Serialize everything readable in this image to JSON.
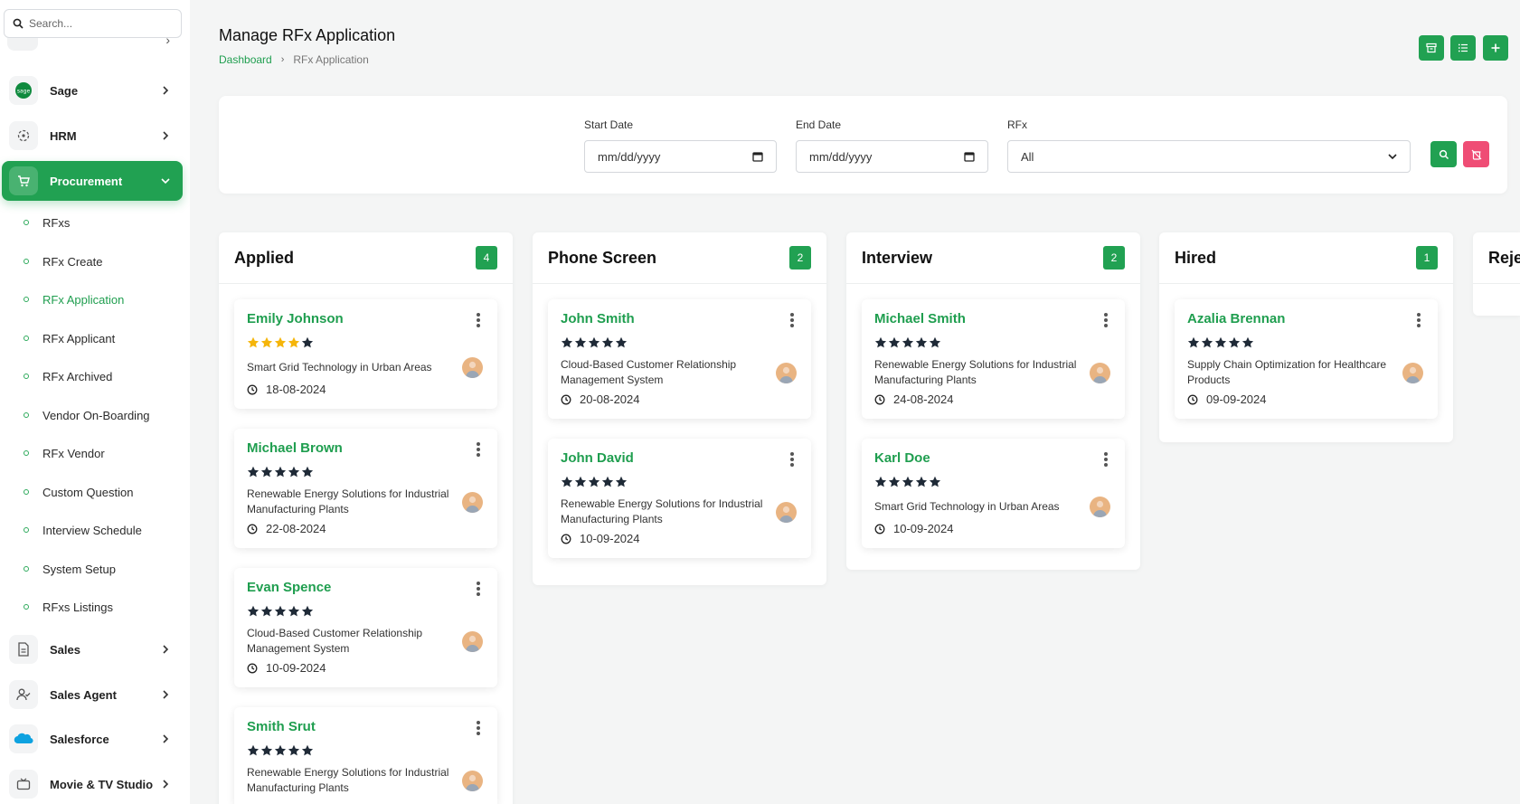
{
  "search": {
    "placeholder": "Search..."
  },
  "sidebar": {
    "items": [
      {
        "label": "Sage",
        "icon": "sage-logo-icon"
      },
      {
        "label": "HRM",
        "icon": "hrm-icon"
      },
      {
        "label": "Procurement",
        "icon": "cart-icon",
        "active": true
      },
      {
        "label": "Sales",
        "icon": "document-icon"
      },
      {
        "label": "Sales Agent",
        "icon": "user-check-icon"
      },
      {
        "label": "Salesforce",
        "icon": "salesforce-cloud-icon"
      },
      {
        "label": "Movie & TV Studio",
        "icon": "tv-icon"
      }
    ],
    "sub_items": [
      "RFxs",
      "RFx Create",
      "RFx Application",
      "RFx Applicant",
      "RFx Archived",
      "Vendor On-Boarding",
      "RFx Vendor",
      "Custom Question",
      "Interview Schedule",
      "System Setup",
      "RFxs Listings"
    ],
    "active_sub_item": "RFx Application"
  },
  "header": {
    "title": "Manage RFx Application",
    "breadcrumb": [
      "Dashboard",
      "RFx Application"
    ]
  },
  "filters": {
    "start_date_label": "Start Date",
    "start_date_value": "mm/dd/yyyy",
    "end_date_label": "End Date",
    "end_date_value": "mm/dd/yyyy",
    "rfx_label": "RFx",
    "rfx_value": "All"
  },
  "colors": {
    "accent": "#21a152",
    "danger": "#ef4d75",
    "star_gold": "#f5b50a",
    "star_dark": "#1f2a37"
  },
  "columns": [
    {
      "title": "Applied",
      "count": "4",
      "cards": [
        {
          "name": "Emily Johnson",
          "rating": 4,
          "description": "Smart Grid Technology in Urban Areas",
          "date": "18-08-2024"
        },
        {
          "name": "Michael Brown",
          "rating": 0,
          "description": "Renewable Energy Solutions for Industrial Manufacturing Plants",
          "date": "22-08-2024"
        },
        {
          "name": "Evan Spence",
          "rating": 0,
          "description": "Cloud-Based Customer Relationship Management System",
          "date": "10-09-2024"
        },
        {
          "name": "Smith Srut",
          "rating": 0,
          "description": "Renewable Energy Solutions for Industrial Manufacturing Plants",
          "date": ""
        }
      ]
    },
    {
      "title": "Phone Screen",
      "count": "2",
      "cards": [
        {
          "name": "John Smith",
          "rating": 0,
          "description": "Cloud-Based Customer Relationship Management System",
          "date": "20-08-2024"
        },
        {
          "name": "John David",
          "rating": 0,
          "description": "Renewable Energy Solutions for Industrial Manufacturing Plants",
          "date": "10-09-2024"
        }
      ]
    },
    {
      "title": "Interview",
      "count": "2",
      "cards": [
        {
          "name": "Michael Smith",
          "rating": 0,
          "description": "Renewable Energy Solutions for Industrial Manufacturing Plants",
          "date": "24-08-2024"
        },
        {
          "name": "Karl Doe",
          "rating": 0,
          "description": "Smart Grid Technology in Urban Areas",
          "date": "10-09-2024"
        }
      ]
    },
    {
      "title": "Hired",
      "count": "1",
      "cards": [
        {
          "name": "Azalia Brennan",
          "rating": 0,
          "description": "Supply Chain Optimization for Healthcare Products",
          "date": "09-09-2024"
        }
      ]
    },
    {
      "title": "Reje",
      "count": "",
      "cards": []
    }
  ]
}
